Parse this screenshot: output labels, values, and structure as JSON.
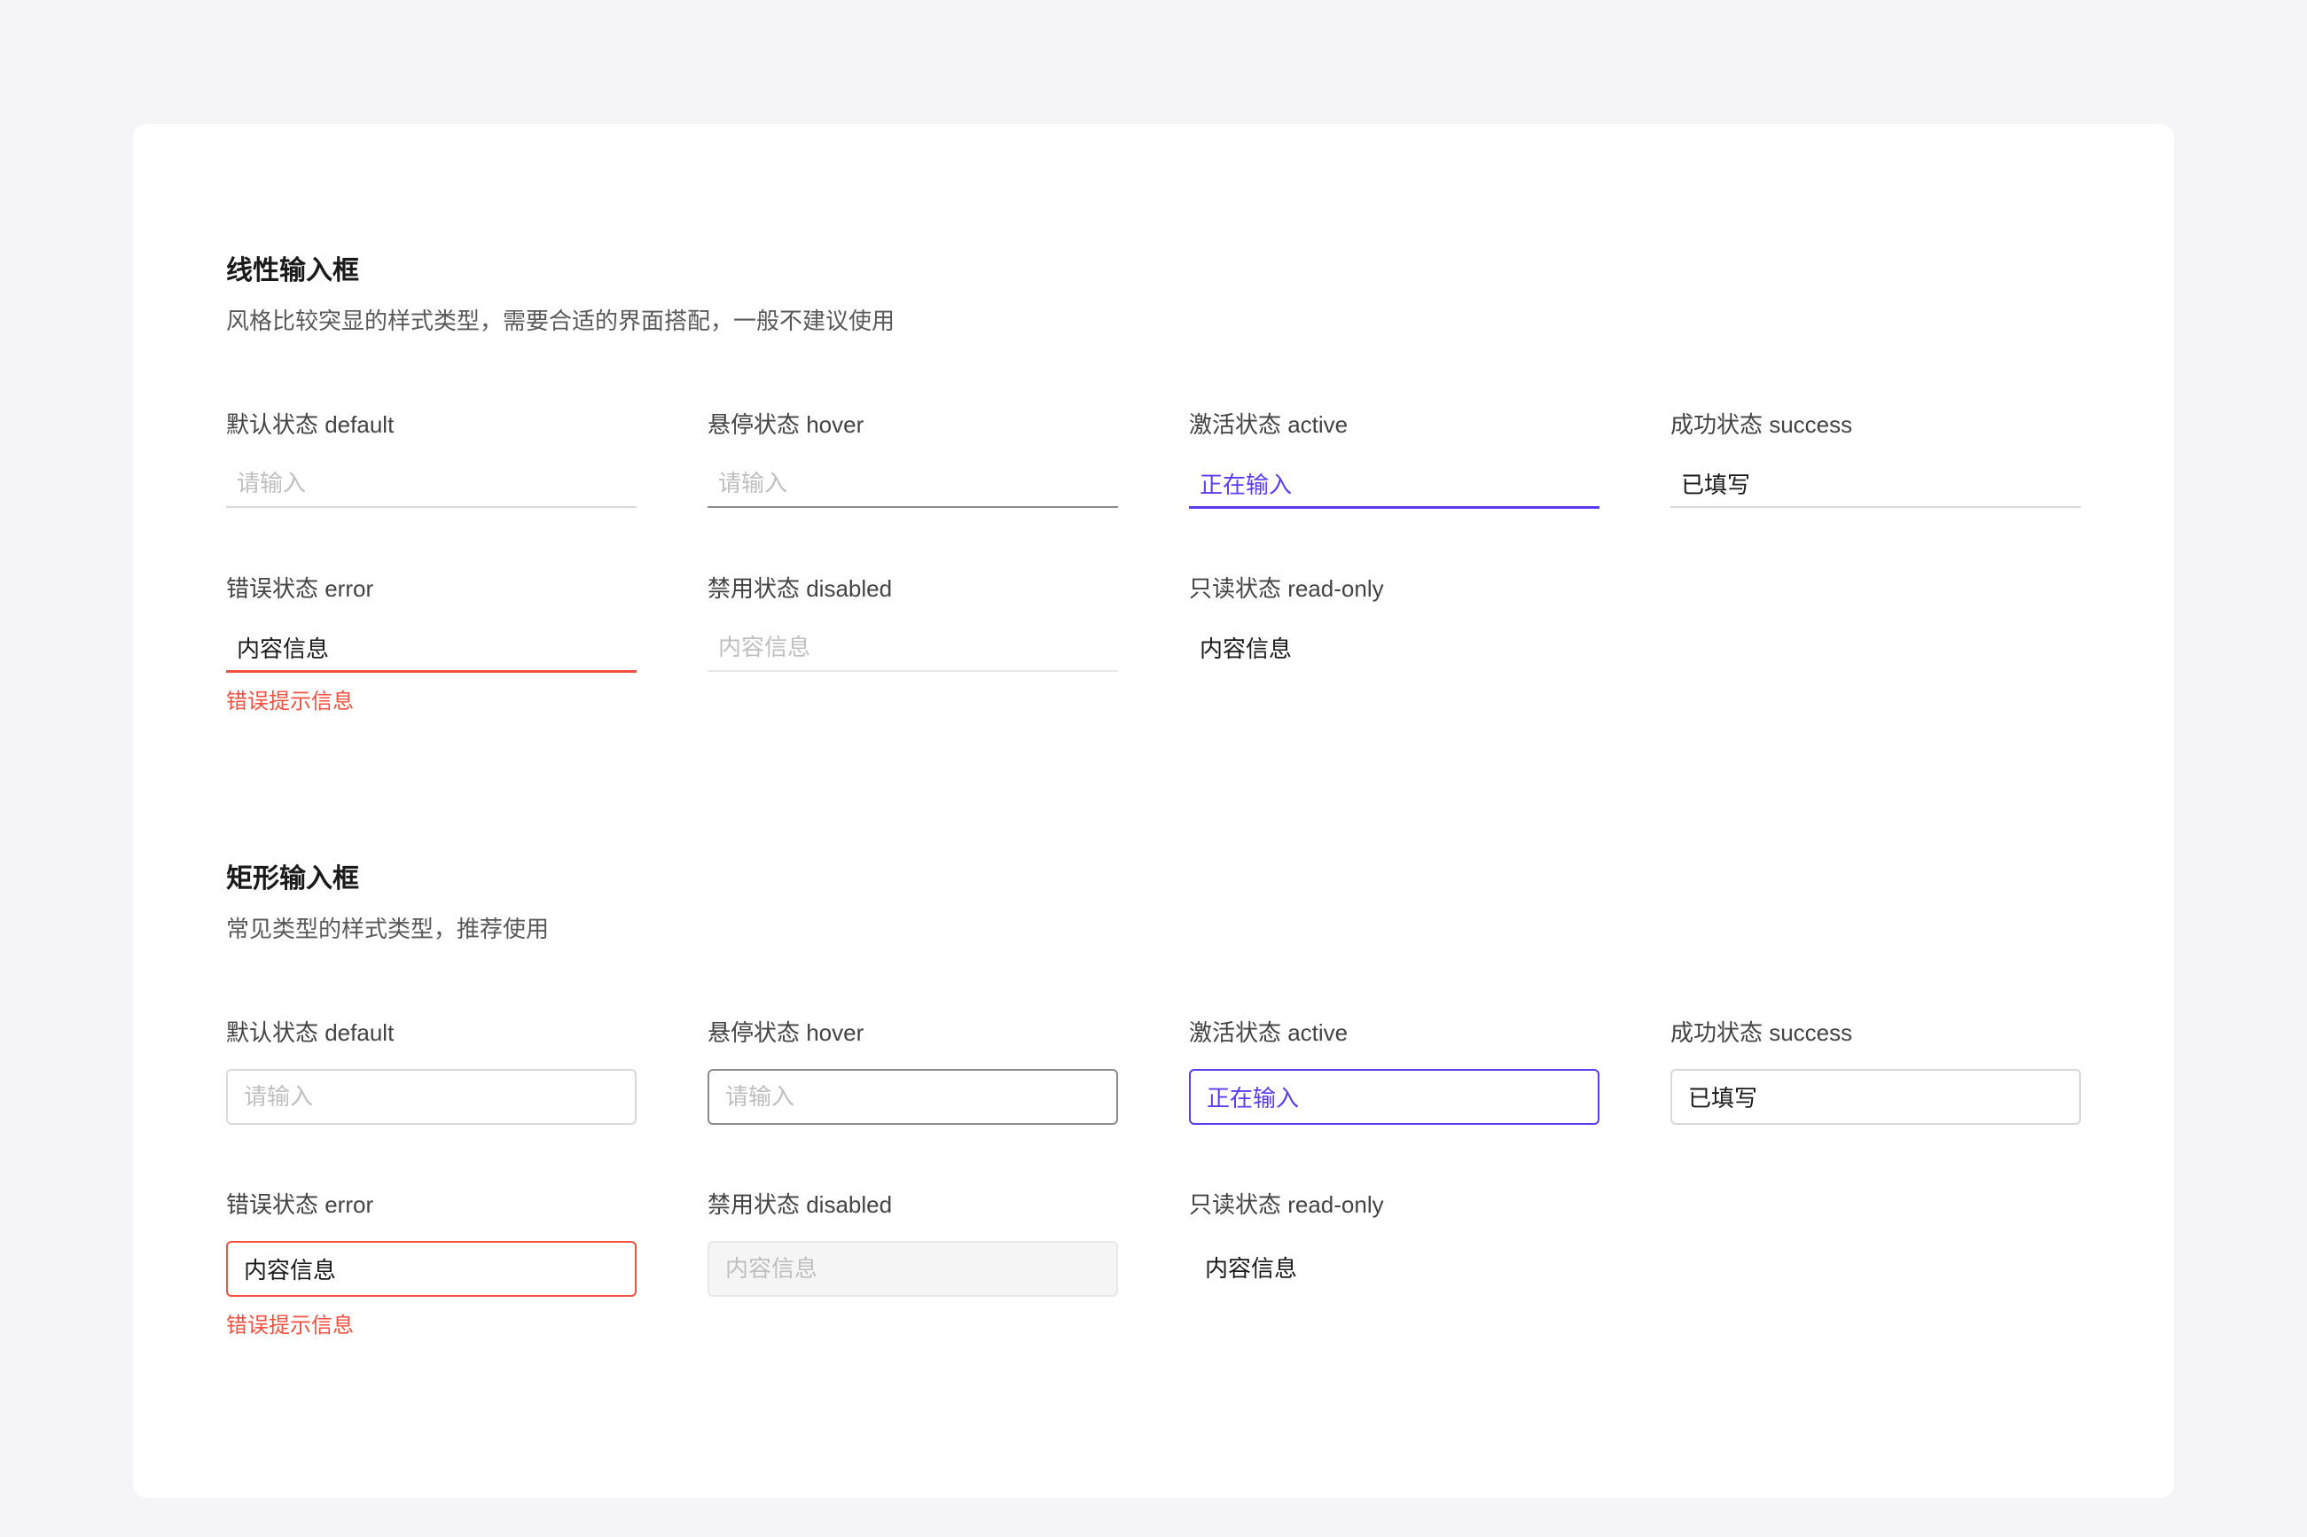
{
  "sections": [
    {
      "title": "线性输入框",
      "desc": "风格比较突显的样式类型，需要合适的界面搭配，一般不建议使用"
    },
    {
      "title": "矩形输入框",
      "desc": "常见类型的样式类型，推荐使用"
    }
  ],
  "labels": {
    "default": "默认状态 default",
    "hover": "悬停状态 hover",
    "active": "激活状态 active",
    "success": "成功状态 success",
    "error": "错误状态 error",
    "disabled": "禁用状态 disabled",
    "readonly": "只读状态 read-only"
  },
  "placeholders": {
    "default": "请输入",
    "hover": "请输入",
    "disabled": "内容信息"
  },
  "values": {
    "active": "正在输入",
    "success": "已填写",
    "error": "内容信息",
    "readonly": "内容信息"
  },
  "errorMessage": "错误提示信息"
}
